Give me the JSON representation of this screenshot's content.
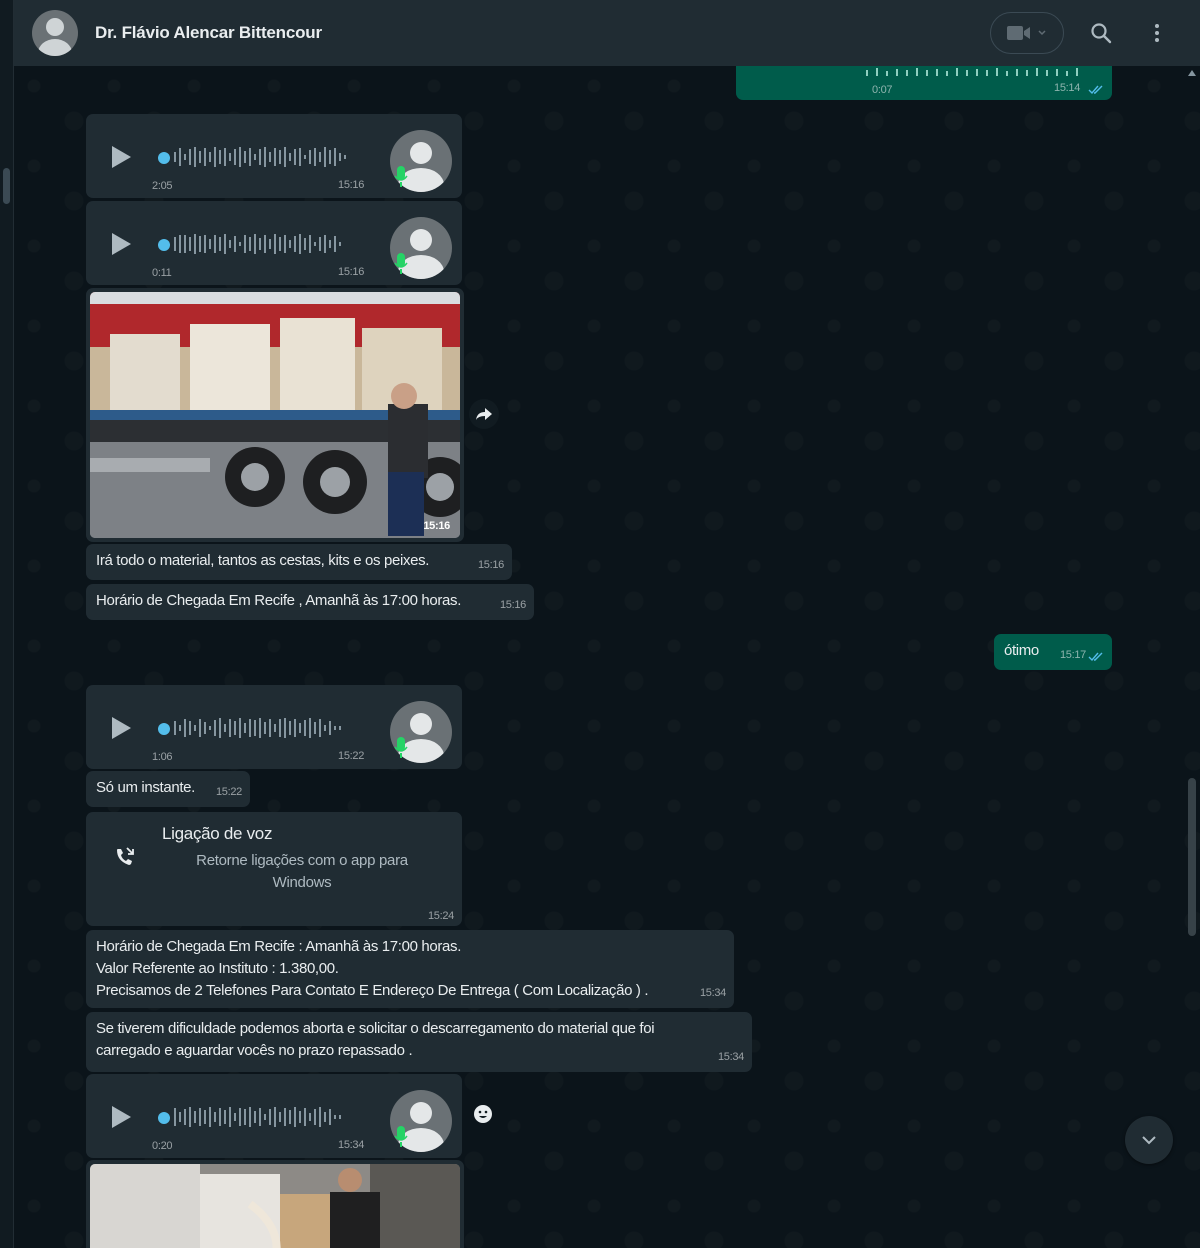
{
  "header": {
    "contact_name": "Dr. Flávio Alencar Bittencour",
    "icons": [
      "avatar",
      "video-call-icon",
      "chevron-down-icon",
      "search-icon",
      "menu-dots-icon"
    ]
  },
  "colors": {
    "incoming_bubble": "#202c33",
    "outgoing_bubble": "#005c4b",
    "accent_blue": "#53bdeb",
    "mic_green": "#25d366"
  },
  "messages": {
    "out_audio_top": {
      "duration": "0:07",
      "time": "15:14"
    },
    "audio1": {
      "duration": "2:05",
      "time": "15:16"
    },
    "audio2": {
      "duration": "0:11",
      "time": "15:16"
    },
    "image1": {
      "time": "15:16"
    },
    "text1": {
      "text": "Irá todo o material, tantos as cestas,  kits e os peixes.",
      "time": "15:16"
    },
    "text2": {
      "text": "Horário de Chegada Em Recife , Amanhã às 17:00 horas.",
      "time": "15:16"
    },
    "out_text": {
      "text": "ótimo",
      "time": "15:17"
    },
    "audio3": {
      "duration": "1:06",
      "time": "15:22"
    },
    "text3": {
      "text": "Só um instante.",
      "time": "15:22"
    },
    "call": {
      "title": "Ligação de voz",
      "subtitle_line1": "Retorne ligações com o app para",
      "subtitle_line2": "Windows",
      "time": "15:24"
    },
    "text4": {
      "line1": "Horário de Chegada Em Recife : Amanhã às 17:00 horas.",
      "line2": "Valor Referente ao Instituto : 1.380,00.",
      "line3": "Precisamos de 2 Telefones Para Contato E Endereço De Entrega ( Com Localização ) .",
      "time": "15:34"
    },
    "text5": {
      "line1": "Se tiverem dificuldade podemos aborta e solicitar o descarregamento do material que foi",
      "line2": "carregado e aguardar vocês no prazo repassado .",
      "time": "15:34"
    },
    "audio4": {
      "duration": "0:20",
      "time": "15:34"
    }
  }
}
